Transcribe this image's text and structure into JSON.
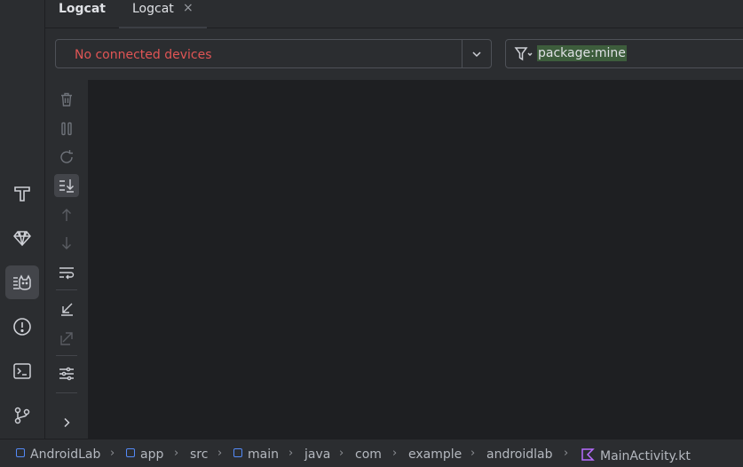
{
  "tool_window": {
    "title": "Logcat",
    "tab_label": "Logcat",
    "tab_close": "×"
  },
  "device_selector": {
    "value": "No connected devices",
    "status_color": "#e05555"
  },
  "filter": {
    "value": "package:mine"
  },
  "left_strip": {
    "items": [
      "build-icon",
      "gem-icon",
      "logcat-icon",
      "problems-icon",
      "terminal-icon",
      "git-icon"
    ],
    "active": "logcat-icon"
  },
  "side_toolbar": {
    "items": [
      "clear-icon",
      "pause-icon",
      "restart-icon",
      "scroll-to-end-icon",
      "up-arrow-icon",
      "down-arrow-icon",
      "soft-wrap-icon",
      "import-icon",
      "export-icon",
      "settings-icon",
      "expand-icon"
    ],
    "active": "scroll-to-end-icon"
  },
  "breadcrumb": [
    "AndroidLab",
    "app",
    "src",
    "main",
    "java",
    "com",
    "example",
    "androidlab",
    "MainActivity.kt"
  ],
  "colors": {
    "background": "#1e1f22",
    "panel": "#2b2d30",
    "module_icon": "#548af7",
    "kotlin_icon": "#b76cff",
    "filter_highlight": "#3d5d3c"
  }
}
